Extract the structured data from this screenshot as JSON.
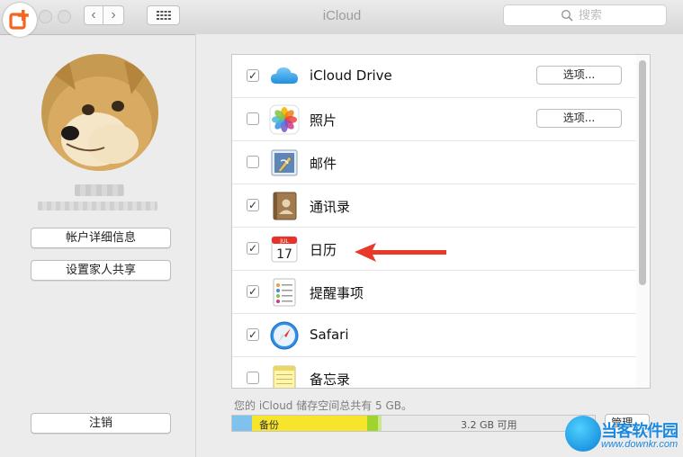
{
  "window": {
    "title": "iCloud"
  },
  "search": {
    "placeholder": "搜索"
  },
  "toolbar": {
    "back_glyph": "‹",
    "forward_glyph": "›"
  },
  "sidebar": {
    "account_details_label": "帐户详细信息",
    "family_sharing_label": "设置家人共享",
    "sign_out_label": "注销"
  },
  "services": [
    {
      "label": "iCloud Drive",
      "checked": true,
      "icon": "icloud-drive-icon",
      "options_label": "选项..."
    },
    {
      "label": "照片",
      "checked": false,
      "icon": "photos-icon",
      "options_label": "选项..."
    },
    {
      "label": "邮件",
      "checked": false,
      "icon": "mail-icon"
    },
    {
      "label": "通讯录",
      "checked": true,
      "icon": "contacts-icon"
    },
    {
      "label": "日历",
      "checked": true,
      "icon": "calendar-icon",
      "calendar_month": "JUL",
      "calendar_day": "17"
    },
    {
      "label": "提醒事项",
      "checked": true,
      "icon": "reminders-icon"
    },
    {
      "label": "Safari",
      "checked": true,
      "icon": "safari-icon"
    },
    {
      "label": "备忘录",
      "checked": false,
      "icon": "notes-icon"
    }
  ],
  "storage": {
    "summary": "您的 iCloud 储存空间总共有 5 GB。",
    "backup_label": "备份",
    "free_label": "3.2 GB 可用",
    "manage_label": "管理..."
  },
  "watermark": {
    "name": "当客软件园",
    "url": "www.downkr.com"
  },
  "colors": {
    "accent_arrow": "#e8392a",
    "storage_blue": "#7fc2ee",
    "storage_yellow": "#f6e52b",
    "storage_green": "#9fd42f",
    "logo_orange": "#f26522"
  }
}
